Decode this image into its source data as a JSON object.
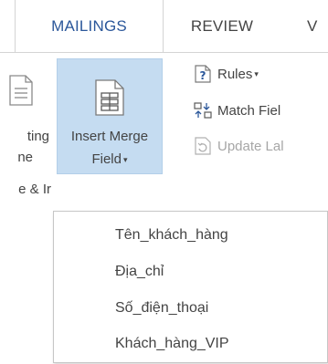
{
  "tabs": [
    {
      "label": "MAILINGS",
      "active": true
    },
    {
      "label": "REVIEW",
      "active": false
    },
    {
      "label": "V",
      "active": false
    }
  ],
  "left_group": {
    "line1": "ting",
    "line2": "ne",
    "group_label": "e & Ir"
  },
  "insert_merge_field": {
    "line1": "Insert Merge",
    "line2": "Field",
    "dropdown_arrow": "▾"
  },
  "right_commands": {
    "rules": {
      "label": "Rules",
      "dropdown_arrow": "▾",
      "icon": "rules-icon"
    },
    "match_fields": {
      "label": "Match Fiel",
      "icon": "match-fields-icon"
    },
    "update_labels": {
      "label": "Update Lal",
      "icon": "update-labels-icon",
      "disabled": true
    }
  },
  "ruler_text": "· · ·",
  "dropdown": {
    "items": [
      {
        "label": "Tên_khách_hàng"
      },
      {
        "label": "Địa_chỉ"
      },
      {
        "label": "Số_điện_thoại"
      },
      {
        "label": "Khách_hàng_VIP"
      }
    ]
  },
  "colors": {
    "accent": "#2b579a",
    "highlight": "#c5dcf1",
    "text": "#444444",
    "disabled_text": "#a6a6a6"
  }
}
